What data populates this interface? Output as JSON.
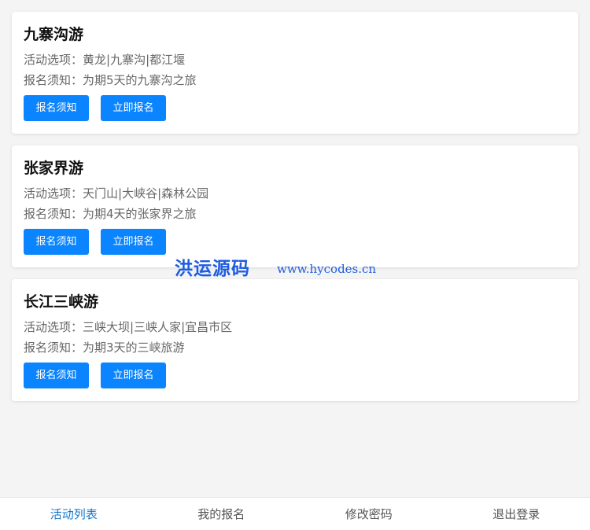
{
  "activities": [
    {
      "title": "九寨沟游",
      "options_label": "活动选项：",
      "options": "黄龙|九寨沟|都江堰",
      "notice_label": "报名须知：",
      "notice": "为期5天的九寨沟之旅",
      "btn_notice": "报名须知",
      "btn_signup": "立即报名"
    },
    {
      "title": "张家界游",
      "options_label": "活动选项：",
      "options": "天门山|大峡谷|森林公园",
      "notice_label": "报名须知：",
      "notice": "为期4天的张家界之旅",
      "btn_notice": "报名须知",
      "btn_signup": "立即报名"
    },
    {
      "title": "长江三峡游",
      "options_label": "活动选项：",
      "options": "三峡大坝|三峡人家|宜昌市区",
      "notice_label": "报名须知：",
      "notice": "为期3天的三峡旅游",
      "btn_notice": "报名须知",
      "btn_signup": "立即报名"
    }
  ],
  "watermark": {
    "text": "洪运源码",
    "url": "www.hycodes.cn"
  },
  "tabbar": {
    "items": [
      "活动列表",
      "我的报名",
      "修改密码",
      "退出登录"
    ],
    "active_index": 0
  },
  "colors": {
    "primary_button": "#0a84ff",
    "active_tab": "#1677c9",
    "watermark": "#1e5ce0",
    "background": "#f4f4f4"
  }
}
